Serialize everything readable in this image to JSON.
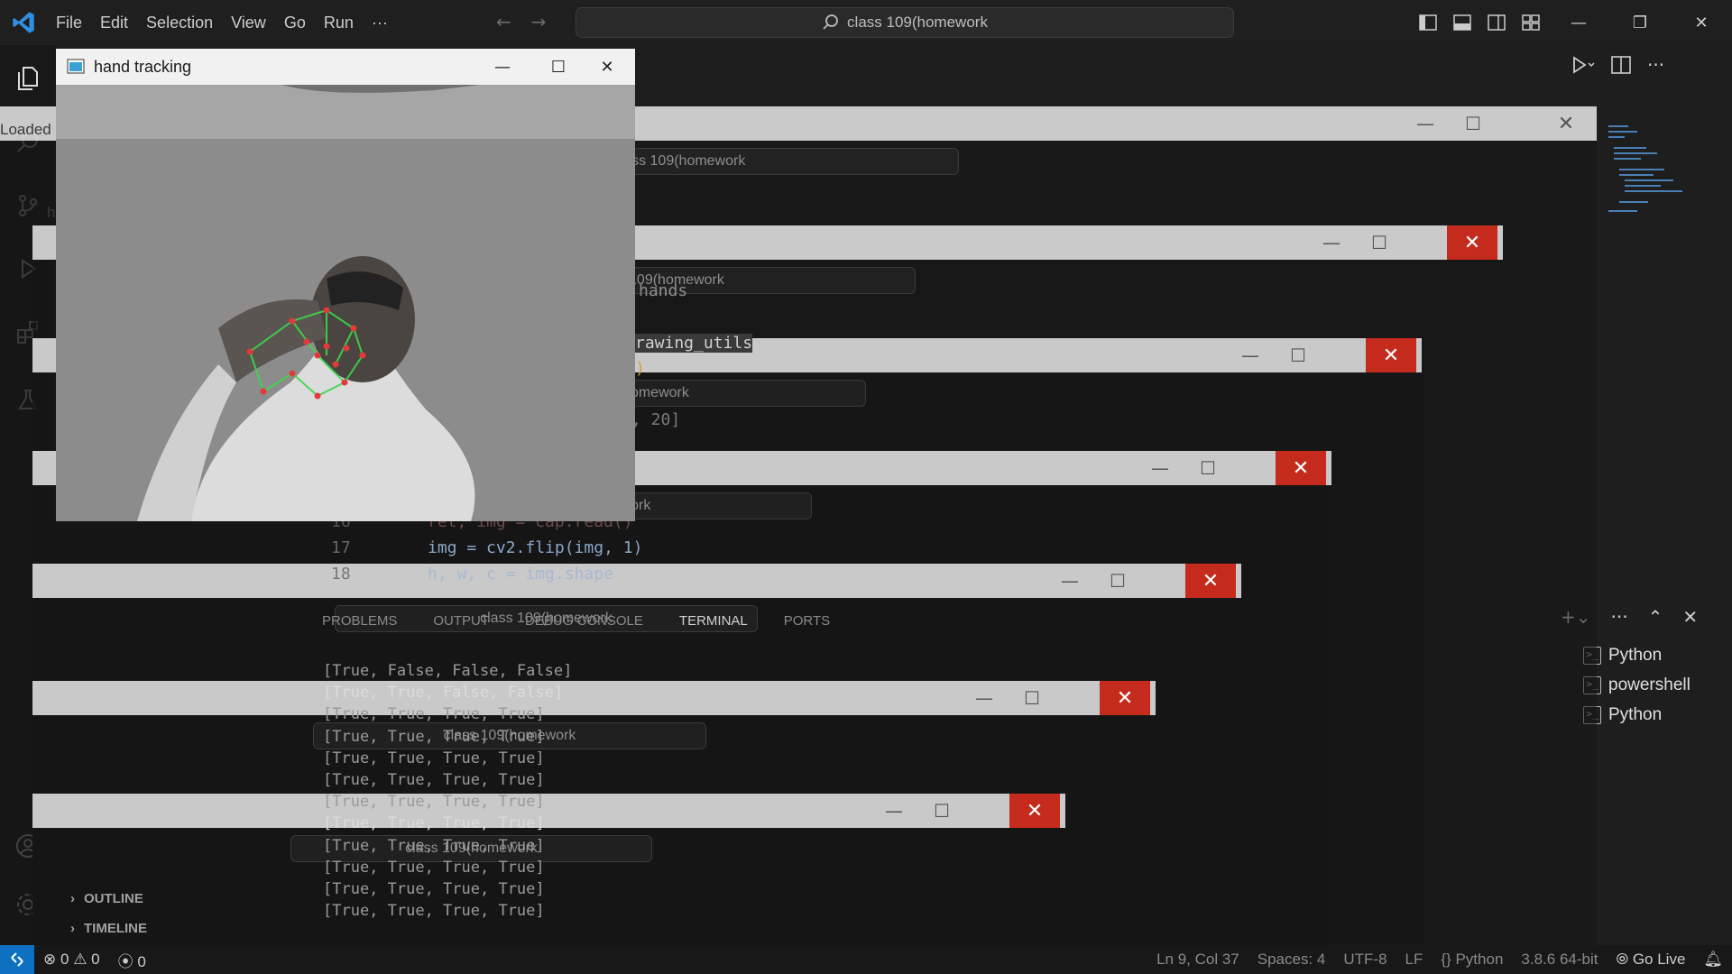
{
  "app": {
    "menu": [
      "File",
      "Edit",
      "Selection",
      "View",
      "Go",
      "Run"
    ],
    "menu_more": "···",
    "search_text": "class 109(homework",
    "nav_back": "←",
    "nav_forward": "→"
  },
  "hand_window": {
    "title": "hand tracking",
    "minimize": "—",
    "maximize": "☐",
    "close": "✕"
  },
  "ghost_windows": {
    "loaded_image_title": "Loaded Image",
    "hand_tracking_title": "hand tracking",
    "search_text": "class 109(homework"
  },
  "editor": {
    "code_fragments": [
      "hands",
      "rawing_utils",
      ")",
      ", 20]",
      "ret, img = cap.read()",
      "img = cv2.flip(img, 1)",
      "h, w, c = img.shape"
    ],
    "line_numbers": [
      "16",
      "17",
      "18"
    ]
  },
  "panel": {
    "tabs": [
      "PROBLEMS",
      "OUTPUT",
      "DEBUG CONSOLE",
      "TERMINAL",
      "PORTS"
    ],
    "active_tab": "TERMINAL",
    "terminal_lines": [
      "[True, False, False, False]",
      "[True, True, False, False]",
      "[True, True, True, True]",
      "[True, True, True, True]",
      "[True, True, True, True]",
      "[True, True, True, True]",
      "[True, True, True, True]",
      "[True, True, True, True]",
      "[True, True, True, True]",
      "[True, True, True, True]",
      "[True, True, True, True]",
      "[True, True, True, True]"
    ],
    "terminals": [
      "Python",
      "powershell",
      "Python"
    ]
  },
  "sidebar": {
    "outline": "OUTLINE",
    "timeline": "TIMELINE"
  },
  "statusbar": {
    "errors": "0",
    "warnings": "0",
    "ports": "0",
    "position": "Ln 9, Col 37",
    "spaces": "Spaces: 4",
    "encoding": "UTF-8",
    "eol": "LF",
    "language": "Python",
    "interpreter": "3.8.6 64-bit",
    "go_live": "Go Live"
  },
  "colors": {
    "accent": "#0e70c0",
    "close_red": "#c42b1c",
    "landmark_green": "#3cd84a",
    "landmark_red": "#e23a3a"
  }
}
